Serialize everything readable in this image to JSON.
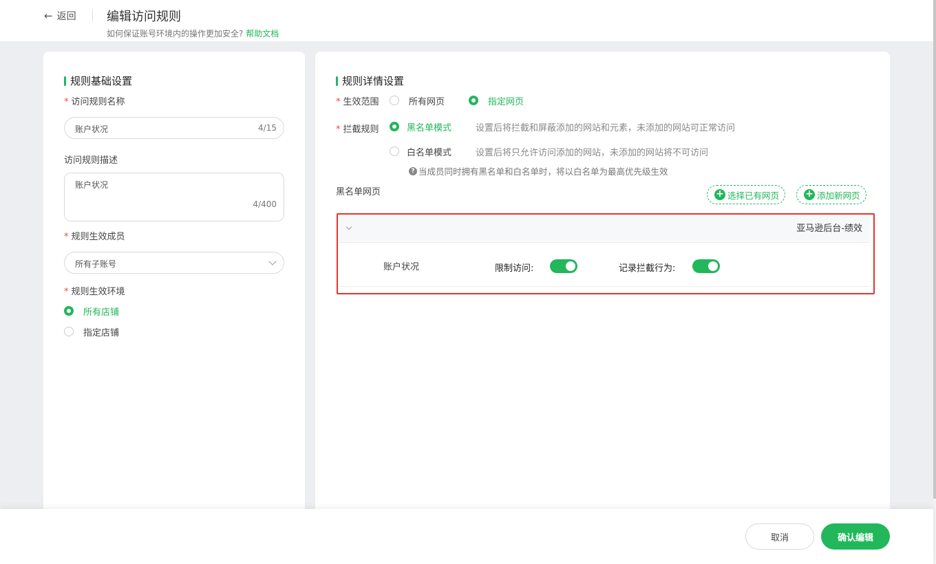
{
  "header": {
    "back_label": "返回",
    "title": "编辑访问规则",
    "subtitle": "如何保证账号环境内的操作更加安全?",
    "help_link": "帮助文档"
  },
  "basic": {
    "section_title": "规则基础设置",
    "name_label": "访问规则名称",
    "name_value": "账户状况",
    "name_count": "4/15",
    "desc_label": "访问规则描述",
    "desc_value": "账户状况",
    "desc_count": "4/400",
    "members_label": "规则生效成员",
    "members_value": "所有子账号",
    "env_label": "规则生效环境",
    "env_options": [
      {
        "label": "所有店铺",
        "selected": true
      },
      {
        "label": "指定店铺",
        "selected": false
      }
    ]
  },
  "detail": {
    "section_title": "规则详情设置",
    "scope_label": "生效范围",
    "scope_options": [
      {
        "label": "所有网页",
        "selected": false
      },
      {
        "label": "指定网页",
        "selected": true
      }
    ],
    "block_label": "拦截规则",
    "block_options": [
      {
        "label": "黑名单模式",
        "hint": "设置后将拦截和屏蔽添加的网站和元素，未添加的网站可正常访问",
        "selected": true
      },
      {
        "label": "白名单模式",
        "hint": "设置后将只允许访问添加的网站，未添加的网站将不可访问",
        "selected": false
      }
    ],
    "note": "当成员同时拥有黑名单和白名单时，将以白名单为最高优先级生效",
    "blacklist_label": "黑名单网页",
    "select_existing_btn": "选择已有网页",
    "add_new_btn": "添加新网页",
    "group_name": "亚马逊后台-绩效",
    "rows": [
      {
        "page": "账户状况",
        "restrict_label": "限制访问:",
        "restrict_on": true,
        "log_label": "记录拦截行为:",
        "log_on": true
      }
    ]
  },
  "footer": {
    "cancel_label": "取消",
    "confirm_label": "确认编辑"
  },
  "colors": {
    "accent": "#21b75a",
    "required": "#f04b3a",
    "highlight_border": "#e6322b"
  }
}
